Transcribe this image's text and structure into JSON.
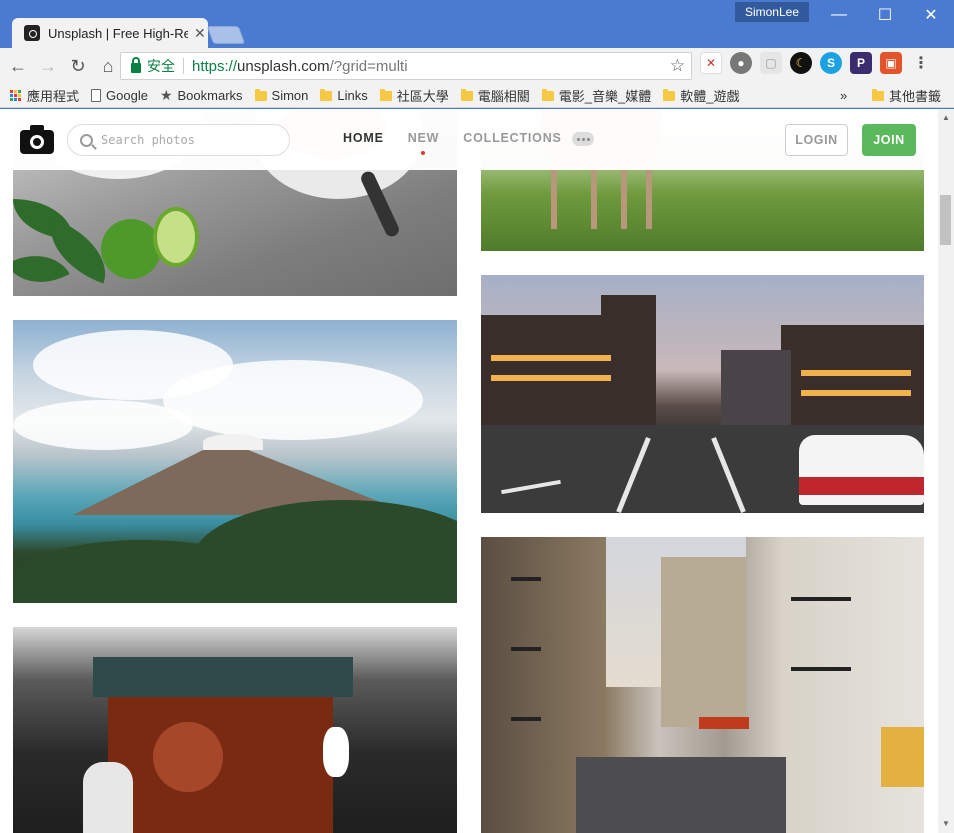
{
  "browser": {
    "tab_title": "Unsplash | Free High-Re",
    "user": "SimonLee",
    "secure_label": "安全",
    "url_scheme": "https://",
    "url_host": "unsplash.com",
    "url_path": "/?grid=multi",
    "window_controls": {
      "minimize": "—",
      "maximize": "☐",
      "close": "✕"
    }
  },
  "bookmarks": [
    {
      "label": "應用程式",
      "type": "apps"
    },
    {
      "label": "Google",
      "type": "page"
    },
    {
      "label": "Bookmarks",
      "type": "star"
    },
    {
      "label": "Simon",
      "type": "folder"
    },
    {
      "label": "Links",
      "type": "folder"
    },
    {
      "label": "社區大學",
      "type": "folder"
    },
    {
      "label": "電腦相關",
      "type": "folder"
    },
    {
      "label": "電影_音樂_媒體",
      "type": "folder"
    },
    {
      "label": "軟體_遊戲",
      "type": "folder"
    }
  ],
  "bookmarks_overflow": "»",
  "bookmarks_other": "其他書籤",
  "site": {
    "search_placeholder": "Search photos",
    "nav": [
      {
        "label": "HOME",
        "active": true
      },
      {
        "label": "NEW",
        "active": false,
        "dot": true
      },
      {
        "label": "COLLECTIONS",
        "active": false
      }
    ],
    "login": "LOGIN",
    "join": "JOIN",
    "brand_green": "#5cb85c"
  },
  "photos": [
    {
      "id": "p1",
      "subject": "coffee cups with limes and mint"
    },
    {
      "id": "p2",
      "subject": "deer on green lawn"
    },
    {
      "id": "p3",
      "subject": "lake and mountains with clouds"
    },
    {
      "id": "p4",
      "subject": "city street at dusk with taxi"
    },
    {
      "id": "p5",
      "subject": "japanese restaurant front with cyclist"
    },
    {
      "id": "p6",
      "subject": "paris street with metropolitain sign"
    }
  ]
}
